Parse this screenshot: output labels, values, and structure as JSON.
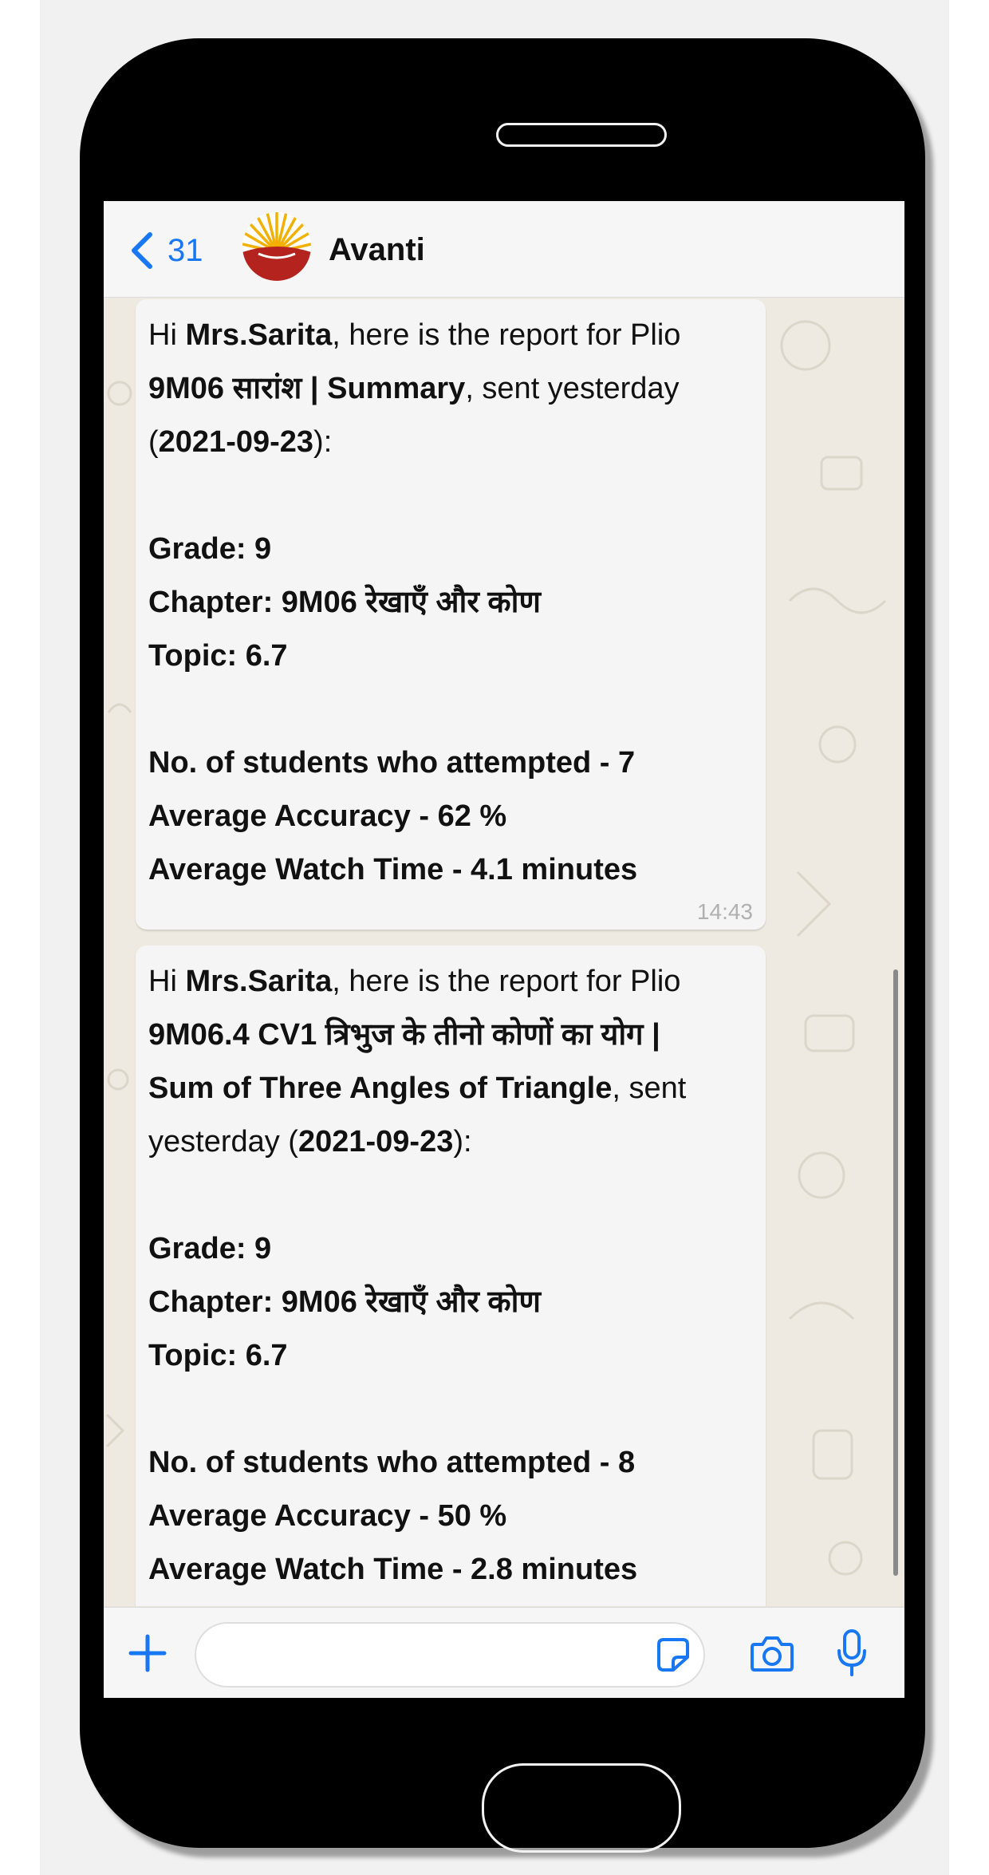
{
  "header": {
    "back_count": "31",
    "chat_name": "Avanti"
  },
  "messages": [
    {
      "lines": [
        [
          {
            "t": "Hi ",
            "b": false
          },
          {
            "t": "Mrs.Sarita",
            "b": true
          },
          {
            "t": ", here is the report for Plio",
            "b": false
          }
        ],
        [
          {
            "t": "9M06 सारांश | Summary",
            "b": true
          },
          {
            "t": ", sent yesterday",
            "b": false
          }
        ],
        [
          {
            "t": "(",
            "b": false
          },
          {
            "t": "2021-09-23",
            "b": true
          },
          {
            "t": "):",
            "b": false
          }
        ],
        [],
        [
          {
            "t": "Grade: 9",
            "b": true
          }
        ],
        [
          {
            "t": "Chapter: 9M06 रेखाएँ और कोण",
            "b": true
          }
        ],
        [
          {
            "t": "Topic: 6.7",
            "b": true
          }
        ],
        [],
        [
          {
            "t": "No. of students who attempted - 7",
            "b": true
          }
        ],
        [
          {
            "t": "Average Accuracy - 62 %",
            "b": true
          }
        ],
        [
          {
            "t": "Average Watch Time - 4.1 minutes",
            "b": true
          }
        ]
      ],
      "time": "14:43"
    },
    {
      "lines": [
        [
          {
            "t": "Hi ",
            "b": false
          },
          {
            "t": "Mrs.Sarita",
            "b": true
          },
          {
            "t": ", here is the report for Plio",
            "b": false
          }
        ],
        [
          {
            "t": "9M06.4 CV1 त्रिभुज के तीनो कोणों का योग |",
            "b": true
          }
        ],
        [
          {
            "t": "Sum of Three Angles of Triangle",
            "b": true
          },
          {
            "t": ", sent",
            "b": false
          }
        ],
        [
          {
            "t": "yesterday (",
            "b": false
          },
          {
            "t": "2021-09-23",
            "b": true
          },
          {
            "t": "):",
            "b": false
          }
        ],
        [],
        [
          {
            "t": "Grade: 9",
            "b": true
          }
        ],
        [
          {
            "t": "Chapter: 9M06 रेखाएँ और कोण",
            "b": true
          }
        ],
        [
          {
            "t": "Topic: 6.7",
            "b": true
          }
        ],
        [],
        [
          {
            "t": "No. of students who attempted - 8",
            "b": true
          }
        ],
        [
          {
            "t": "Average Accuracy - 50 %",
            "b": true
          }
        ],
        [
          {
            "t": "Average Watch Time - 2.8 minutes",
            "b": true
          }
        ]
      ],
      "time": ""
    }
  ],
  "composer": {
    "input_value": "",
    "icons": [
      "plus-icon",
      "sticker-icon",
      "camera-icon",
      "microphone-icon"
    ]
  },
  "colors": {
    "accent": "#1877f2",
    "bubble": "#f5f5f5",
    "wallpaper": "#eeeae1"
  }
}
